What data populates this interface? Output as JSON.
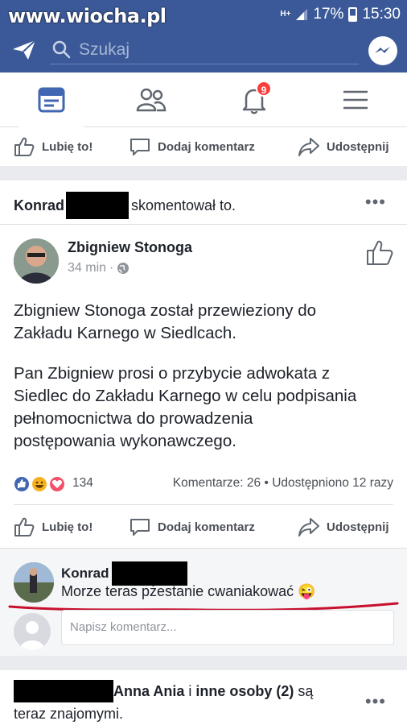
{
  "watermark": "www.wiocha.pl",
  "status": {
    "network": "H+",
    "battery": "17%",
    "time": "15:30"
  },
  "search": {
    "placeholder": "Szukaj"
  },
  "nav": {
    "notifications_badge": "9"
  },
  "actions": {
    "like": "Lubię to!",
    "comment": "Dodaj komentarz",
    "share": "Udostępnij"
  },
  "activity": {
    "actor": "Konrad",
    "text": "skomentował to."
  },
  "post": {
    "author": "Zbigniew Stonoga",
    "time": "34 min",
    "paragraph1_line1": "Zbigniew Stonoga został przewieziony do",
    "paragraph1_line2": "Zakładu Karnego w Siedlcach.",
    "paragraph2_line1": "Pan Zbigniew prosi o przybycie adwokata z",
    "paragraph2_line2": "Siedlec do Zakładu Karnego w celu podpisania",
    "paragraph2_line3": "pełnomocnictwa do prowadzenia",
    "paragraph2_line4": "postępowania wykonawczego.",
    "reactions_count": "134",
    "comments_shares": "Komentarze: 26 • Udostępniono 12 razy"
  },
  "comment": {
    "author": "Konrad",
    "text": "Morze teras pżestanie cwaniakować",
    "emoji": "😜"
  },
  "composer": {
    "placeholder": "Napisz komentarz..."
  },
  "friends": {
    "names": "Anna Ania",
    "conj": "i",
    "others": "inne osoby (2)",
    "verb": "są",
    "line2": "teraz znajomymi."
  },
  "colors": {
    "brand": "#3b5998",
    "underline": "#c8102e"
  }
}
